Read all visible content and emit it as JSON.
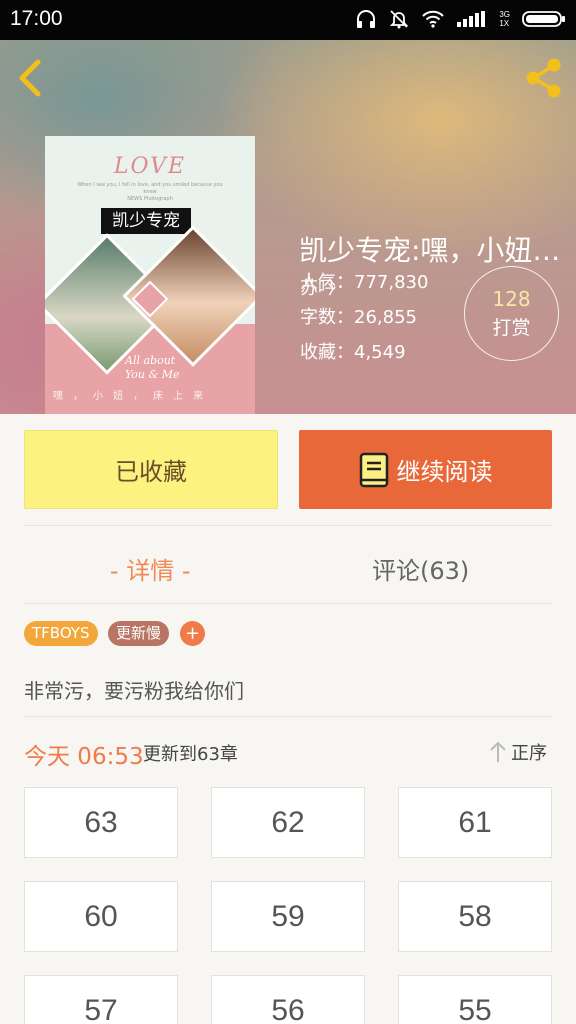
{
  "status_bar": {
    "time": "17:00",
    "network_top": "3G",
    "network_bottom": "1X"
  },
  "header": {
    "back_icon": "chevron-left-icon",
    "share_icon": "share-icon",
    "accent_color": "#f3c01b"
  },
  "book": {
    "title": "凯少专宠:嘿，小妞…",
    "author": "苏吟",
    "popularity": "人气：777,830",
    "word_count": "字数：26,855",
    "favorites": "收藏：4,549",
    "reward_count": "128",
    "reward_label": "打赏",
    "cover": {
      "heading": "LOVE",
      "subtext": "When I see you, I fell in love, and you smiled because you knew",
      "caption": "NEWS Photograph",
      "title": "凯少专宠",
      "script_line1": "All about",
      "script_line2": "You & Me",
      "bottom_strip": "嘿，小妞，床上来"
    }
  },
  "actions": {
    "favorited_label": "已收藏",
    "continue_label": "继续阅读",
    "favorited_color": "#fcf27f",
    "continue_color": "#e8683a"
  },
  "tabs": {
    "detail": "- 详情 -",
    "comments": "评论(63)"
  },
  "tags": {
    "tag1": "TFBOYS",
    "tag2": "更新慢",
    "add": "+"
  },
  "description": "非常污，要污粉我给你们",
  "update": {
    "time": "今天 06:53",
    "text": "更新到63章",
    "sort_label": "正序"
  },
  "chapters": [
    "63",
    "62",
    "61",
    "60",
    "59",
    "58",
    "57",
    "56",
    "55"
  ]
}
